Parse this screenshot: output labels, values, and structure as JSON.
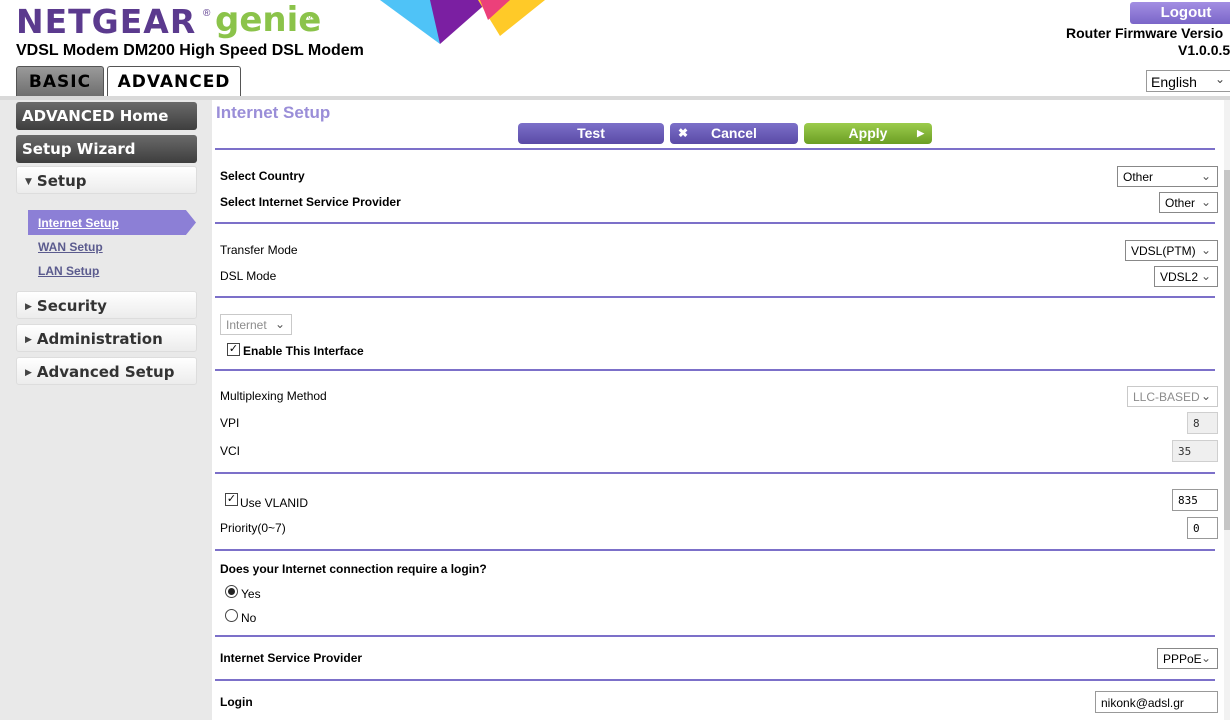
{
  "header": {
    "brand": "NETGEAR",
    "brand_suffix": "genie",
    "reg_mark": "®",
    "model": "VDSL Modem DM200 High Speed DSL Modem",
    "logout_label": "Logout",
    "firmware_label": "Router Firmware Versio",
    "firmware_version": "V1.0.0.5",
    "language": "English",
    "tabs": [
      {
        "label": "BASIC"
      },
      {
        "label": "ADVANCED"
      }
    ]
  },
  "sidebar": {
    "advanced_home": "ADVANCED Home",
    "setup_wizard": "Setup Wizard",
    "setup": "Setup",
    "sub_items": [
      "Internet Setup",
      "WAN Setup",
      "LAN Setup"
    ],
    "security": "Security",
    "administration": "Administration",
    "advanced_setup": "Advanced Setup"
  },
  "main": {
    "title": "Internet Setup",
    "buttons": {
      "test": "Test",
      "cancel": "Cancel",
      "apply": "Apply"
    },
    "country": {
      "label": "Select Country",
      "value": "Other"
    },
    "isp_select": {
      "label": "Select Internet Service Provider",
      "value": "Other"
    },
    "transfer_mode": {
      "label": "Transfer Mode",
      "value": "VDSL(PTM)"
    },
    "dsl_mode": {
      "label": "DSL Mode",
      "value": "VDSL2"
    },
    "interface": {
      "value": "Internet"
    },
    "enable_interface": {
      "label": "Enable This Interface",
      "checked": true
    },
    "multiplexing": {
      "label": "Multiplexing Method",
      "value": "LLC-BASED"
    },
    "vpi": {
      "label": "VPI",
      "value": "8"
    },
    "vci": {
      "label": "VCI",
      "value": "35"
    },
    "vlan": {
      "label": "Use VLANID",
      "value": "835",
      "checked": true
    },
    "priority": {
      "label": "Priority(0~7)",
      "value": "0"
    },
    "login_question": "Does your Internet connection require a login?",
    "login_yes": "Yes",
    "login_no": "No",
    "isp": {
      "label": "Internet Service Provider",
      "value": "PPPoE"
    },
    "login": {
      "label": "Login",
      "value": "nikonk@adsl.gr"
    }
  },
  "colors": {
    "brand_purple": "#5b3a8e",
    "brand_green": "#8bc34a",
    "accent": "#7c70c9",
    "apply_green": "#7fb234"
  }
}
